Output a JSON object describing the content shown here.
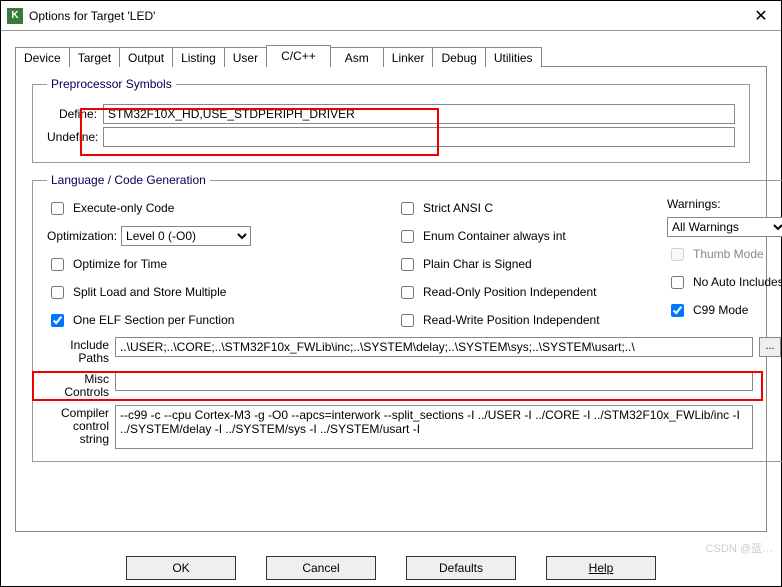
{
  "window": {
    "title": "Options for Target 'LED'",
    "icon_letter": "K"
  },
  "tabs": {
    "items": [
      {
        "label": "Device"
      },
      {
        "label": "Target"
      },
      {
        "label": "Output"
      },
      {
        "label": "Listing"
      },
      {
        "label": "User"
      },
      {
        "label": "C/C++"
      },
      {
        "label": "Asm"
      },
      {
        "label": "Linker"
      },
      {
        "label": "Debug"
      },
      {
        "label": "Utilities"
      }
    ],
    "active_index": 5
  },
  "preprocessor": {
    "legend": "Preprocessor Symbols",
    "define_label": "Define:",
    "define_value": "STM32F10X_HD,USE_STDPERIPH_DRIVER",
    "undefine_label": "Undefine:",
    "undefine_value": ""
  },
  "language": {
    "legend": "Language / Code Generation",
    "col1": {
      "execute_only": {
        "label": "Execute-only Code",
        "checked": false
      },
      "optimization_label": "Optimization:",
      "optimization_value": "Level 0 (-O0)",
      "optimize_time": {
        "label": "Optimize for Time",
        "checked": false
      },
      "split_load": {
        "label": "Split Load and Store Multiple",
        "checked": false
      },
      "one_elf": {
        "label": "One ELF Section per Function",
        "checked": true
      }
    },
    "col2": {
      "strict_ansi": {
        "label": "Strict ANSI C",
        "checked": false
      },
      "enum_container": {
        "label": "Enum Container always int",
        "checked": false
      },
      "plain_char": {
        "label": "Plain Char is Signed",
        "checked": false
      },
      "ro_pos": {
        "label": "Read-Only Position Independent",
        "checked": false
      },
      "rw_pos": {
        "label": "Read-Write Position Independent",
        "checked": false
      }
    },
    "col3": {
      "warnings_label": "Warnings:",
      "warnings_value": "All Warnings",
      "thumb_mode": {
        "label": "Thumb Mode",
        "checked": false,
        "disabled": true
      },
      "no_auto_inc": {
        "label": "No Auto Includes",
        "checked": false
      },
      "c99_mode": {
        "label": "C99 Mode",
        "checked": true
      }
    }
  },
  "paths": {
    "include_paths_label": "Include\nPaths",
    "include_paths_value": "..\\USER;..\\CORE;..\\STM32F10x_FWLib\\inc;..\\SYSTEM\\delay;..\\SYSTEM\\sys;..\\SYSTEM\\usart;..\\",
    "browse_label": "...",
    "misc_controls_label": "Misc\nControls",
    "misc_controls_value": "",
    "compiler_string_label": "Compiler\ncontrol\nstring",
    "compiler_string_value": "--c99 -c --cpu Cortex-M3 -g -O0 --apcs=interwork --split_sections -I ../USER -I ../CORE -I ../STM32F10x_FWLib/inc -I ../SYSTEM/delay -I ../SYSTEM/sys -I ../SYSTEM/usart -I"
  },
  "buttons": {
    "ok": "OK",
    "cancel": "Cancel",
    "defaults": "Defaults",
    "help": "Help"
  },
  "watermark": "CSDN @蓝…"
}
